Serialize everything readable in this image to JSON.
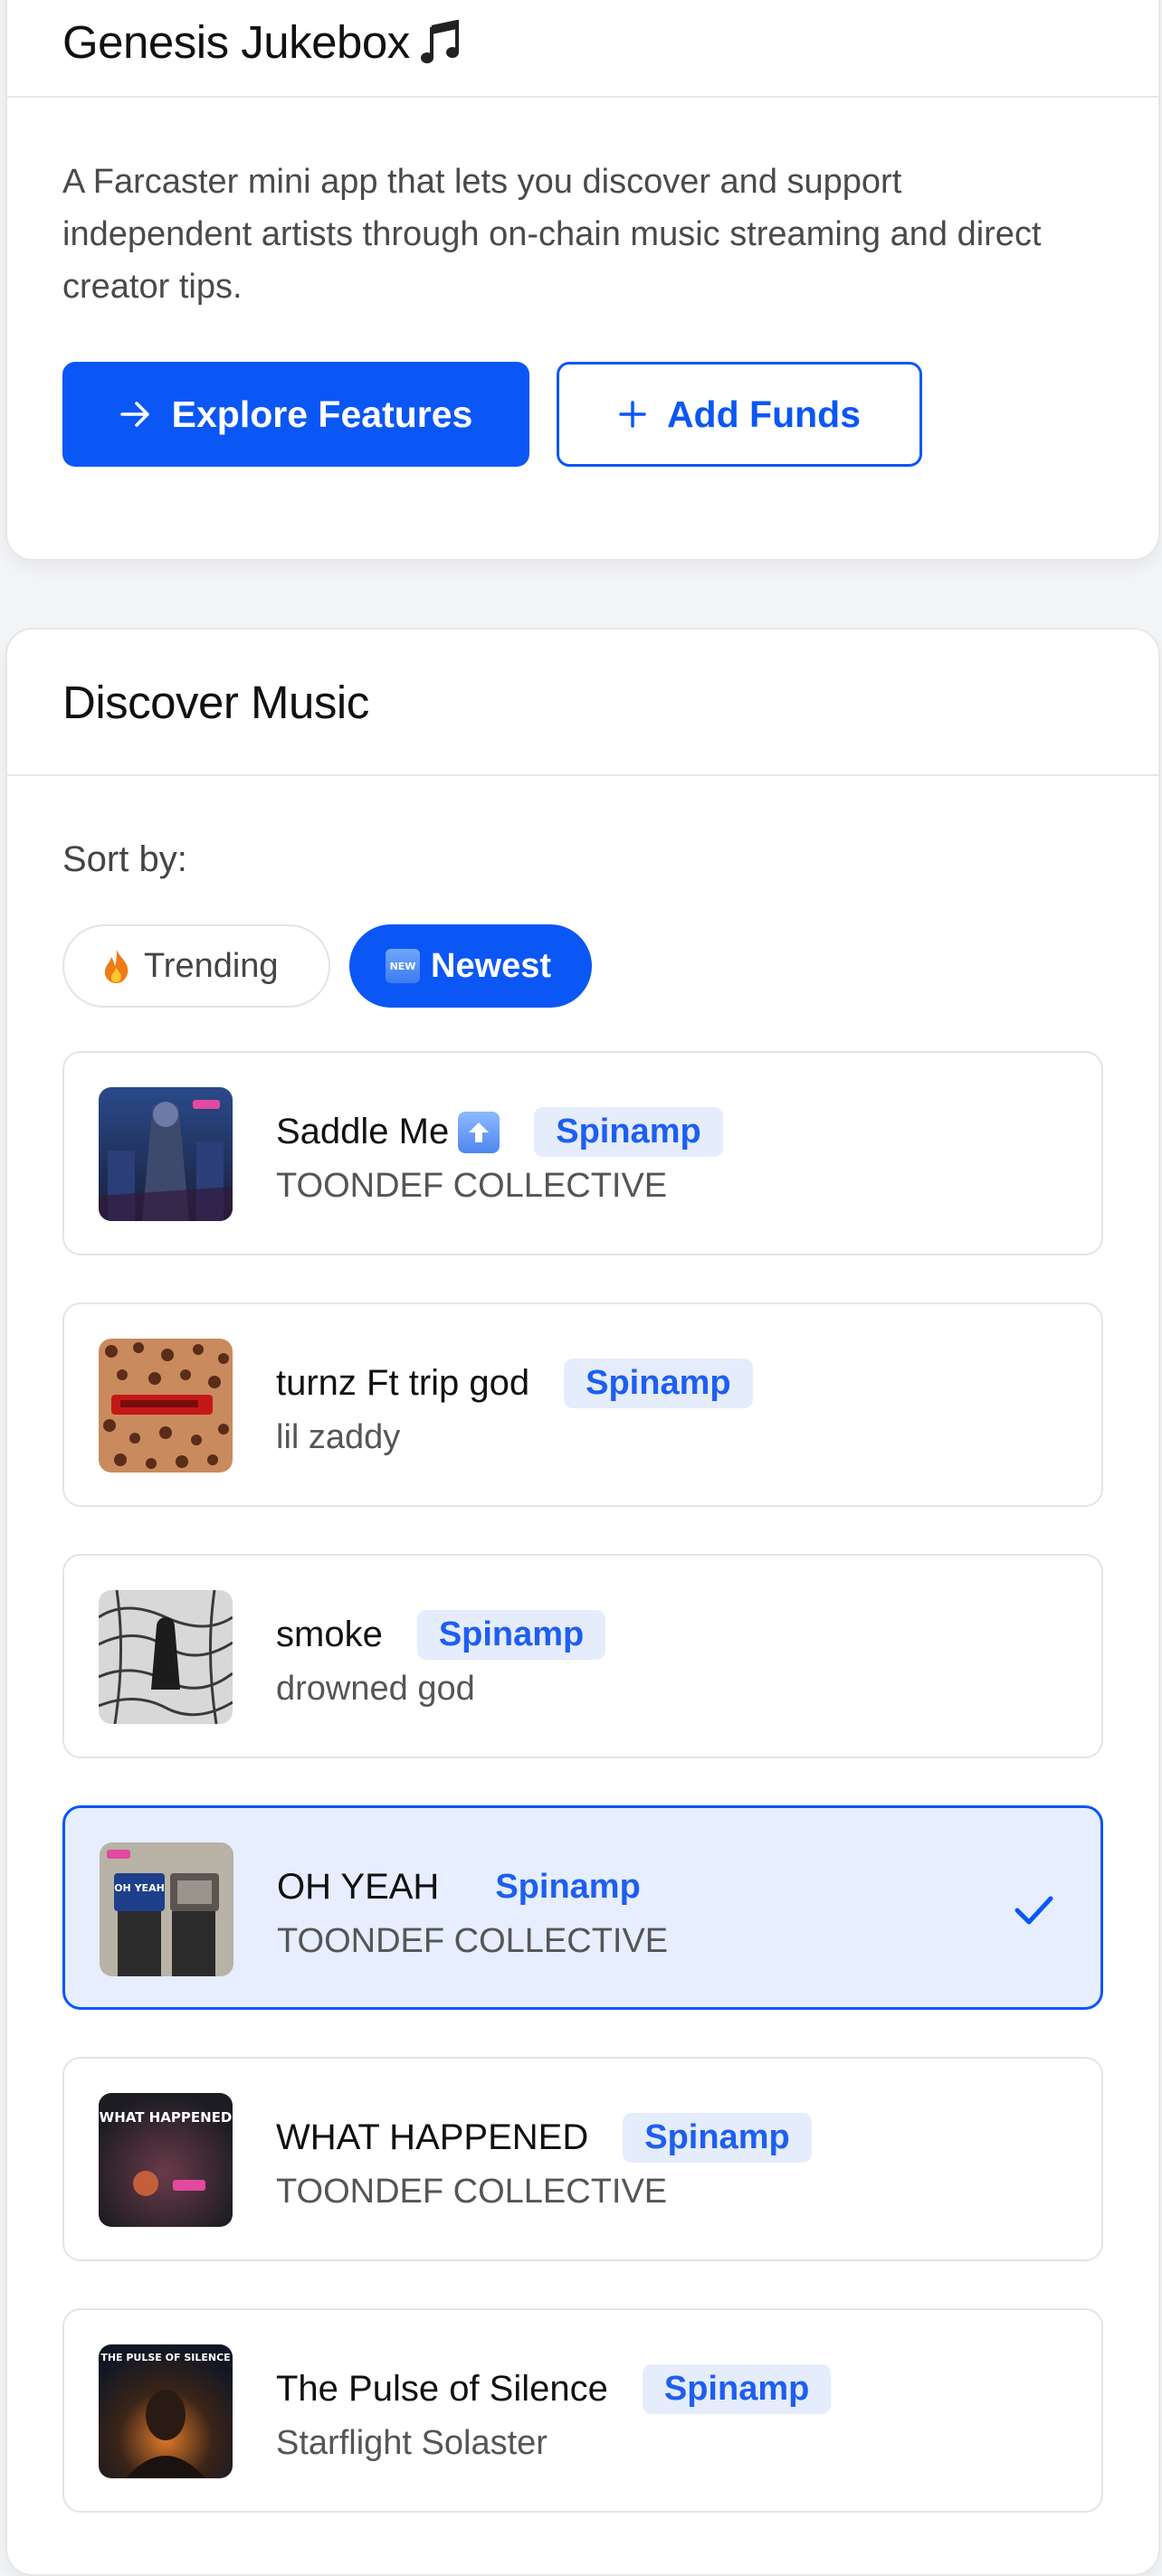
{
  "intro": {
    "title": "Genesis Jukebox",
    "title_icon": "music-note-icon",
    "description": "A Farcaster mini app that lets you discover and support independent artists through on-chain music streaming and direct creator tips.",
    "explore_label": "Explore Features",
    "add_funds_label": "Add Funds"
  },
  "discover": {
    "title": "Discover Music",
    "sort_label": "Sort by:",
    "sort_options": [
      {
        "label": "Trending",
        "icon": "fire-icon",
        "active": false
      },
      {
        "label": "Newest",
        "icon": "new-icon",
        "active": true
      }
    ],
    "tracks": [
      {
        "title": "Saddle Me",
        "title_icon": "up-arrow-icon",
        "artist": "TOONDEF COLLECTIVE",
        "source": "Spinamp",
        "selected": false
      },
      {
        "title": "turnz Ft trip god",
        "artist": "lil zaddy",
        "source": "Spinamp",
        "selected": false
      },
      {
        "title": "smoke",
        "artist": "drowned god",
        "source": "Spinamp",
        "selected": false
      },
      {
        "title": "OH YEAH",
        "artist": "TOONDEF COLLECTIVE",
        "source": "Spinamp",
        "selected": true
      },
      {
        "title": "WHAT HAPPENED",
        "artist": "TOONDEF COLLECTIVE",
        "source": "Spinamp",
        "selected": false
      },
      {
        "title": "The Pulse of Silence",
        "artist": "Starflight Solaster",
        "source": "Spinamp",
        "selected": false
      }
    ],
    "art_captions": {
      "what_happened": "WHAT HAPPENED",
      "pulse": "THE PULSE OF SILENCE",
      "oh_yeah": "OH YEAH"
    }
  },
  "colors": {
    "accent": "#0b57f5",
    "selected_bg": "#e6eeff",
    "tag_bg": "#e5ecfb"
  }
}
